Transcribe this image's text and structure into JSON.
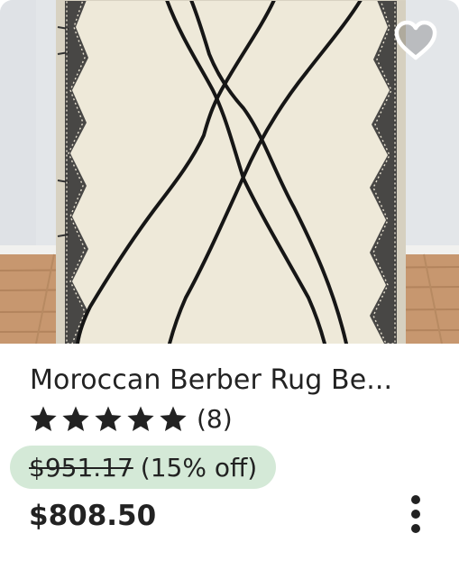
{
  "listing": {
    "title": "Moroccan Berber Rug Be...",
    "image": "moroccan-berber-rug-photo",
    "favorite_icon": "heart-outline-icon",
    "rating": {
      "stars": 5,
      "max_stars": 5,
      "review_count": "(8)"
    },
    "original_price": "$951.17",
    "discount": "(15% off)",
    "price": "$808.50",
    "more_icon": "more-vertical-icon"
  },
  "colors": {
    "text": "#222222",
    "discount_bg": "#d4e9d7",
    "rug_base": "#ece6d6",
    "rug_lines": "#1a1a1a",
    "wall": "#e4e7ea",
    "floor": "#c89972"
  }
}
